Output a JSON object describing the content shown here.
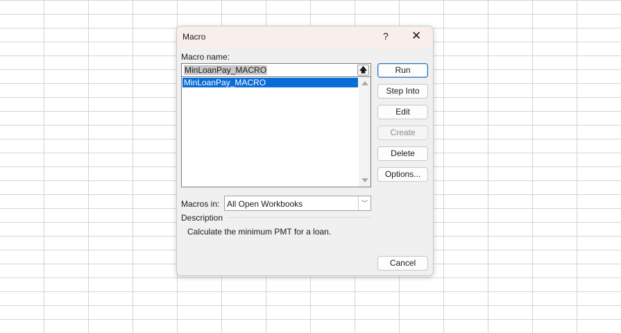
{
  "dialog": {
    "title": "Macro",
    "help": "?",
    "close": "✕",
    "macro_name_label": "Macro name:",
    "macro_name_value": "MinLoanPay_MACRO",
    "macros": [
      "MinLoanPay_MACRO"
    ],
    "macros_in_label": "Macros in:",
    "macros_in_value": "All Open Workbooks",
    "description_label": "Description",
    "description": "Calculate the minimum PMT for a loan.",
    "buttons": {
      "run": "Run",
      "step_into": "Step Into",
      "edit": "Edit",
      "create": "Create",
      "delete": "Delete",
      "options": "Options...",
      "cancel": "Cancel"
    }
  }
}
